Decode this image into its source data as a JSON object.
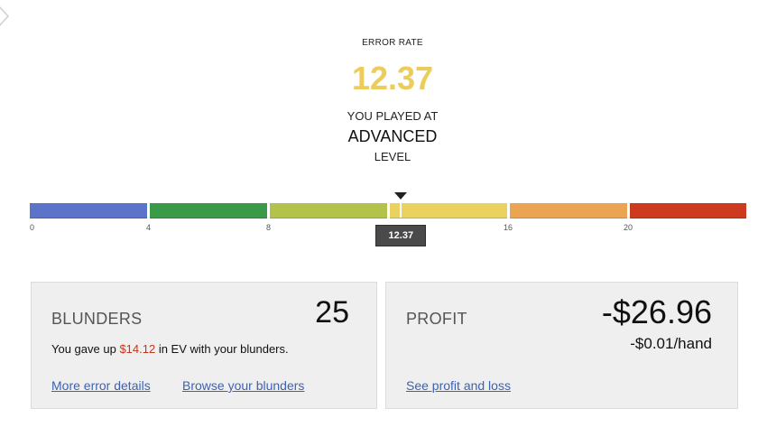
{
  "summary": {
    "error_rate_label": "ERROR RATE",
    "error_rate_value": "12.37",
    "played_at": "YOU PLAYED AT",
    "level_name": "ADVANCED",
    "level_word": "LEVEL"
  },
  "scale": {
    "min": 0,
    "max": 24,
    "value": 12.37,
    "marker_label": "12.37",
    "ticks": [
      "0",
      "4",
      "8",
      "16",
      "20"
    ],
    "colors": [
      "#5b73c8",
      "#3a9a48",
      "#b2c24a",
      "#ebd25e",
      "#eba552",
      "#cc3a1f"
    ]
  },
  "blunders": {
    "title": "BLUNDERS",
    "count": "25",
    "text_before": "You gave up ",
    "amount": "$14.12",
    "text_after": " in EV with your blunders.",
    "link_errors": "More error details",
    "link_browse": "Browse your blunders"
  },
  "profit": {
    "title": "PROFIT",
    "value": "-$26.96",
    "per_hand": "-$0.01/hand",
    "link": "See profit and loss"
  }
}
